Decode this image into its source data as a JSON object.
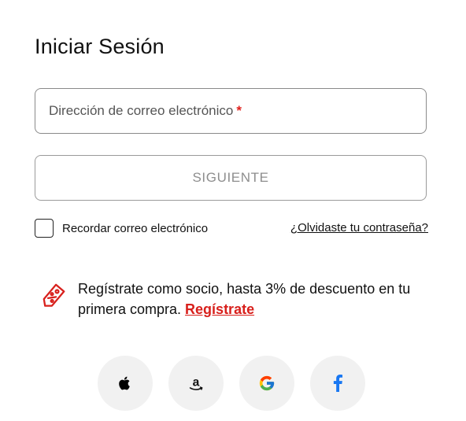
{
  "login": {
    "title": "Iniciar Sesión",
    "email_placeholder": "Dirección de correo electrónico",
    "required_mark": "*",
    "next_label": "SIGUIENTE",
    "remember_label": "Recordar correo electrónico",
    "forgot_label": "¿Olvidaste tu contraseña?"
  },
  "promo": {
    "text": "Regístrate como socio, hasta 3% de descuento en tu primera compra. ",
    "link_label": "Regístrate",
    "icon": "discount-tag-icon"
  },
  "social": {
    "buttons": [
      {
        "provider": "apple",
        "icon": "apple-icon"
      },
      {
        "provider": "amazon",
        "icon": "amazon-icon"
      },
      {
        "provider": "google",
        "icon": "google-icon"
      },
      {
        "provider": "facebook",
        "icon": "facebook-icon"
      }
    ]
  },
  "colors": {
    "accent": "#d8201c",
    "facebook": "#1877f2"
  }
}
